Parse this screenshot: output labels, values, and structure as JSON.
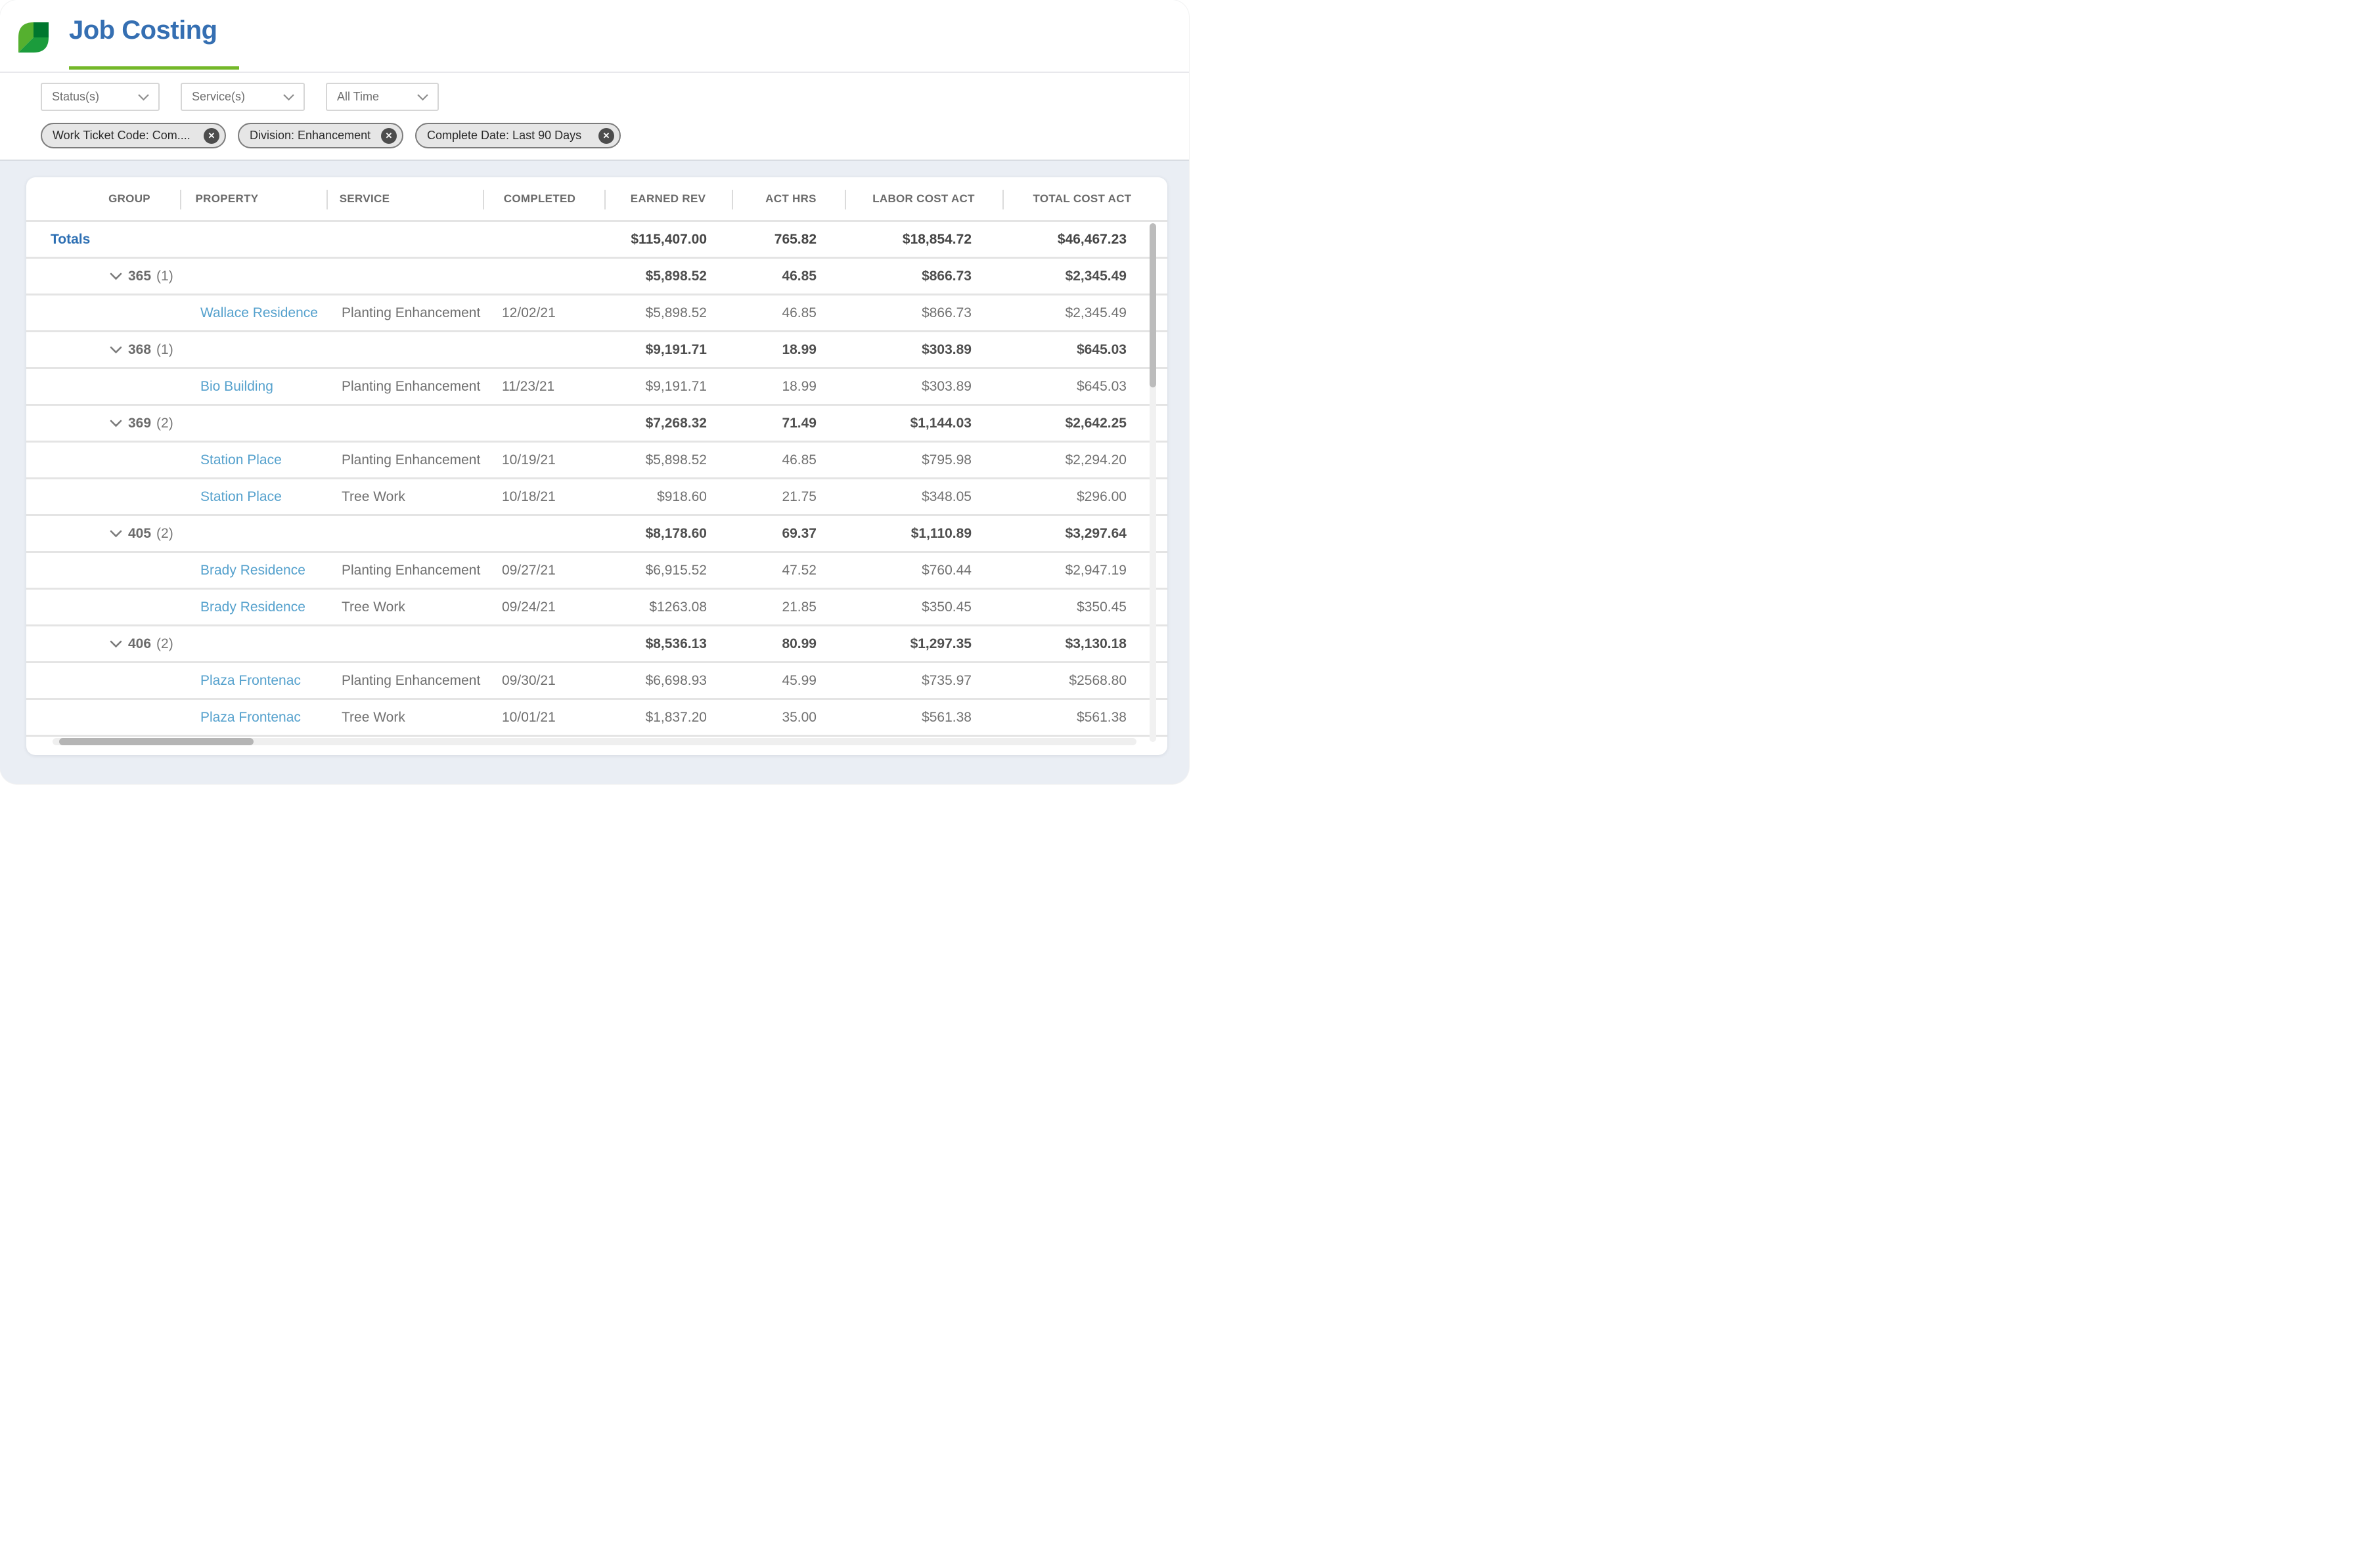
{
  "app": {
    "title": "Job Costing"
  },
  "colors": {
    "accent_blue": "#356FB2",
    "underline_green": "#74B829",
    "link_blue": "#55A1CD",
    "leaf_light_green": "#55B02F",
    "leaf_dark_green": "#00772E",
    "leaf_mid_green": "#1B9C3C",
    "page_background": "#EAEEF4"
  },
  "filters": {
    "dropdowns": [
      {
        "label": "Status(s)"
      },
      {
        "label": "Service(s)"
      },
      {
        "label": "All Time"
      }
    ],
    "chips": [
      {
        "label": "Work Ticket Code: Com...."
      },
      {
        "label": "Division: Enhancement"
      },
      {
        "label": "Complete Date: Last 90 Days"
      }
    ],
    "remove_icon": "✕"
  },
  "table": {
    "columns": {
      "group": "GROUP",
      "property": "PROPERTY",
      "service": "SERVICE",
      "completed": "COMPLETED",
      "earned_rev": "EARNED REV",
      "act_hrs": "ACT HRS",
      "labor_cost_act": "LABOR COST ACT",
      "total_cost_act": "TOTAL COST ACT"
    },
    "totals": {
      "label": "Totals",
      "earned_rev": "$115,407.00",
      "act_hrs": "765.82",
      "labor_cost_act": "$18,854.72",
      "total_cost_act": "$46,467.23"
    },
    "rows": [
      {
        "type": "group",
        "label": "365",
        "count": "(1)",
        "earned_rev": "$5,898.52",
        "act_hrs": "46.85",
        "labor_cost_act": "$866.73",
        "total_cost_act": "$2,345.49"
      },
      {
        "type": "detail",
        "property": "Wallace Residence",
        "service": "Planting Enhancement",
        "completed": "12/02/21",
        "earned_rev": "$5,898.52",
        "act_hrs": "46.85",
        "labor_cost_act": "$866.73",
        "total_cost_act": "$2,345.49"
      },
      {
        "type": "group",
        "label": "368",
        "count": "(1)",
        "earned_rev": "$9,191.71",
        "act_hrs": "18.99",
        "labor_cost_act": "$303.89",
        "total_cost_act": "$645.03"
      },
      {
        "type": "detail",
        "property": "Bio Building",
        "service": "Planting Enhancement",
        "completed": "11/23/21",
        "earned_rev": "$9,191.71",
        "act_hrs": "18.99",
        "labor_cost_act": "$303.89",
        "total_cost_act": "$645.03"
      },
      {
        "type": "group",
        "label": "369",
        "count": "(2)",
        "earned_rev": "$7,268.32",
        "act_hrs": "71.49",
        "labor_cost_act": "$1,144.03",
        "total_cost_act": "$2,642.25"
      },
      {
        "type": "detail",
        "property": "Station Place",
        "service": "Planting Enhancement",
        "completed": "10/19/21",
        "earned_rev": "$5,898.52",
        "act_hrs": "46.85",
        "labor_cost_act": "$795.98",
        "total_cost_act": "$2,294.20"
      },
      {
        "type": "detail",
        "property": "Station Place",
        "service": "Tree Work",
        "completed": "10/18/21",
        "earned_rev": "$918.60",
        "act_hrs": "21.75",
        "labor_cost_act": "$348.05",
        "total_cost_act": "$296.00"
      },
      {
        "type": "group",
        "label": "405",
        "count": "(2)",
        "earned_rev": "$8,178.60",
        "act_hrs": "69.37",
        "labor_cost_act": "$1,110.89",
        "total_cost_act": "$3,297.64"
      },
      {
        "type": "detail",
        "property": "Brady Residence",
        "service": "Planting Enhancement",
        "completed": "09/27/21",
        "earned_rev": "$6,915.52",
        "act_hrs": "47.52",
        "labor_cost_act": "$760.44",
        "total_cost_act": "$2,947.19"
      },
      {
        "type": "detail",
        "property": "Brady Residence",
        "service": "Tree Work",
        "completed": "09/24/21",
        "earned_rev": "$1263.08",
        "act_hrs": "21.85",
        "labor_cost_act": "$350.45",
        "total_cost_act": "$350.45"
      },
      {
        "type": "group",
        "label": "406",
        "count": "(2)",
        "earned_rev": "$8,536.13",
        "act_hrs": "80.99",
        "labor_cost_act": "$1,297.35",
        "total_cost_act": "$3,130.18"
      },
      {
        "type": "detail",
        "property": "Plaza Frontenac",
        "service": "Planting Enhancement",
        "completed": "09/30/21",
        "earned_rev": "$6,698.93",
        "act_hrs": "45.99",
        "labor_cost_act": "$735.97",
        "total_cost_act": "$2568.80"
      },
      {
        "type": "detail",
        "property": "Plaza Frontenac",
        "service": "Tree Work",
        "completed": "10/01/21",
        "earned_rev": "$1,837.20",
        "act_hrs": "35.00",
        "labor_cost_act": "$561.38",
        "total_cost_act": "$561.38"
      }
    ]
  }
}
